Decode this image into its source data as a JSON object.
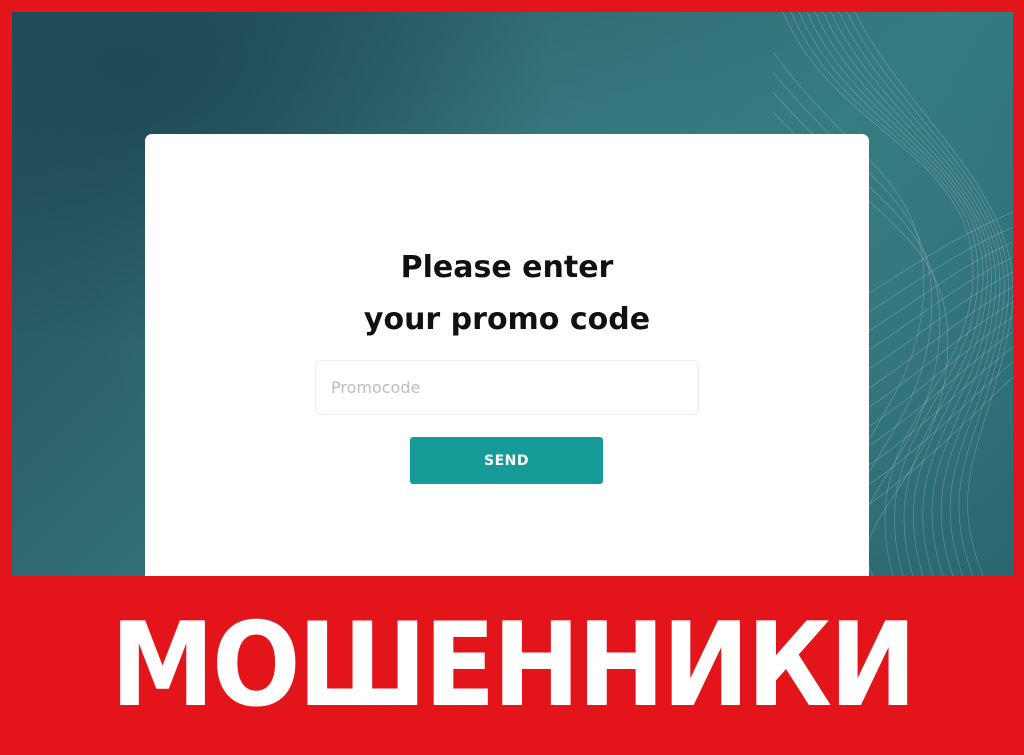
{
  "card": {
    "heading_line1": "Please enter",
    "heading_line2": "your promo code",
    "input_placeholder": "Promocode",
    "input_value": "",
    "send_label": "SEND"
  },
  "banner": {
    "text": "МОШЕННИКИ"
  },
  "colors": {
    "frame_red": "#e3151a",
    "button_teal": "#159b98",
    "background_teal": "#2f6870"
  }
}
